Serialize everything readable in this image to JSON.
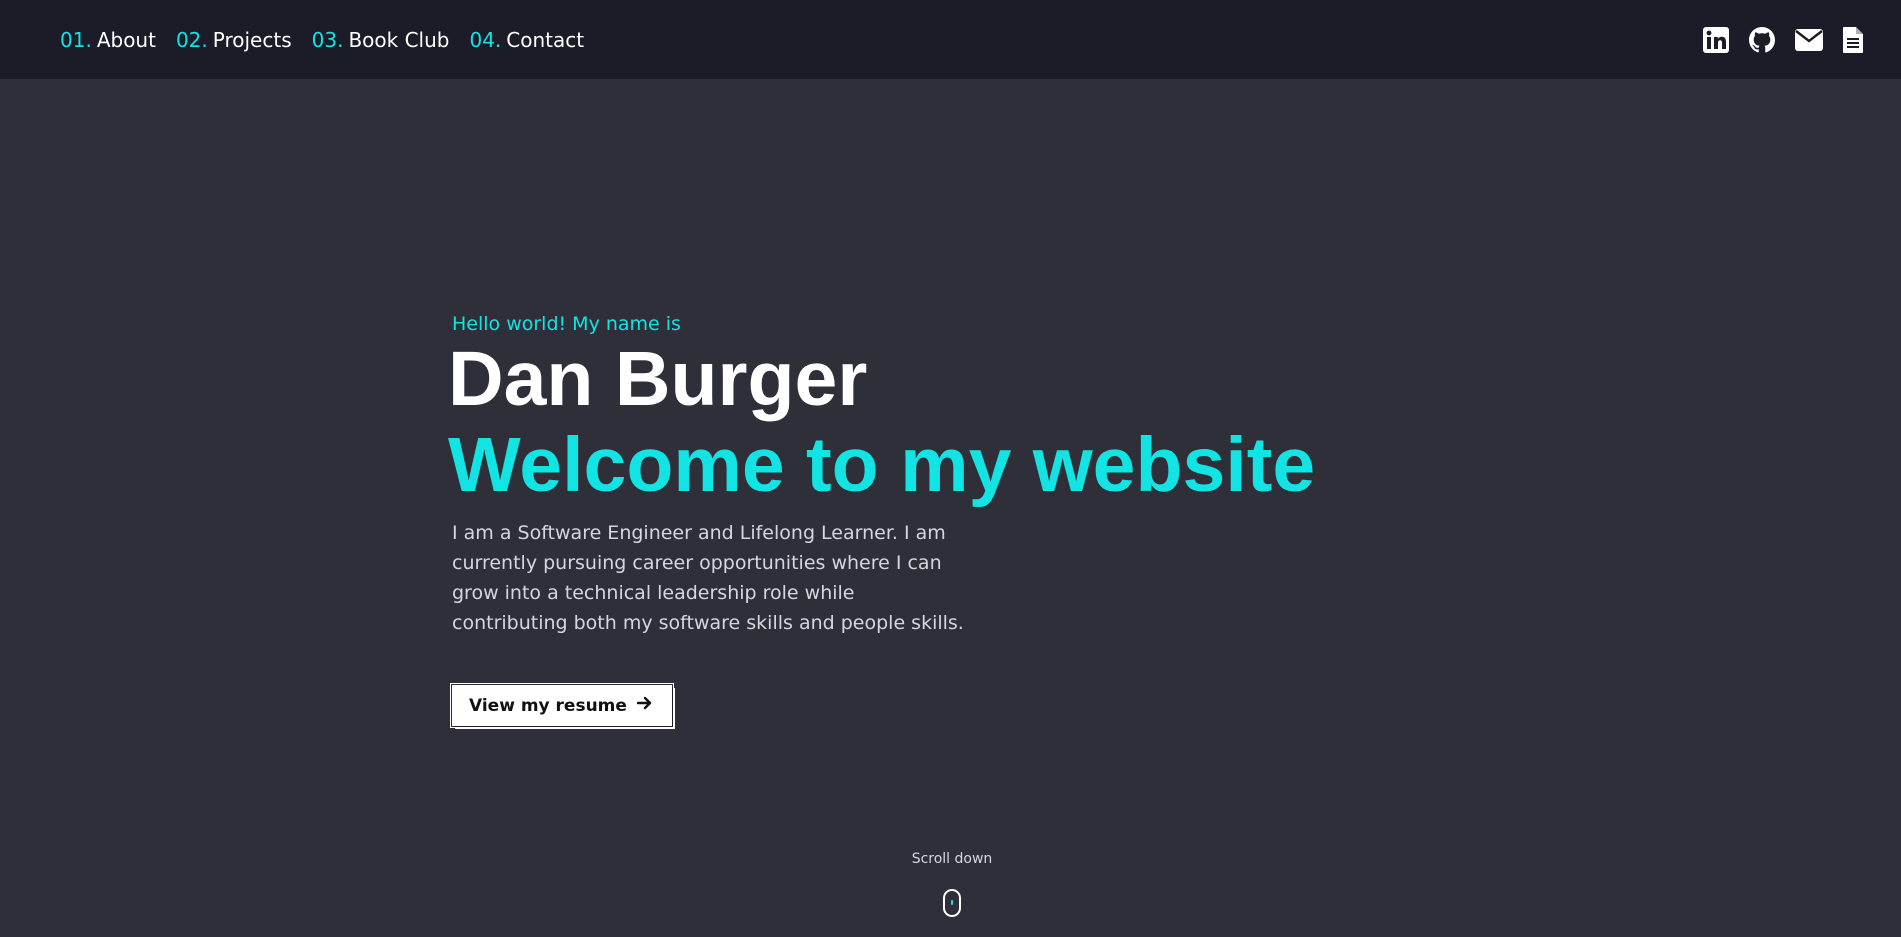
{
  "nav": {
    "items": [
      {
        "num": "01.",
        "label": "About"
      },
      {
        "num": "02.",
        "label": "Projects"
      },
      {
        "num": "03.",
        "label": "Book Club"
      },
      {
        "num": "04.",
        "label": "Contact"
      }
    ],
    "social": [
      "linkedin-icon",
      "github-icon",
      "mail-icon",
      "resume-document-icon"
    ]
  },
  "hero": {
    "greeting": "Hello world! My name is",
    "name": "Dan Burger",
    "tagline": "Welcome to my website",
    "intro": "I am a Software Engineer and Lifelong Learner. I am currently pursuing career opportunities where I can grow into a technical leadership role while contributing both my software skills and people skills.",
    "button_label": "View my resume"
  },
  "scroll": {
    "label": "Scroll down"
  },
  "colors": {
    "accent": "#12e4e4",
    "background": "#2f2f3a",
    "navbar": "#1b1c28"
  }
}
